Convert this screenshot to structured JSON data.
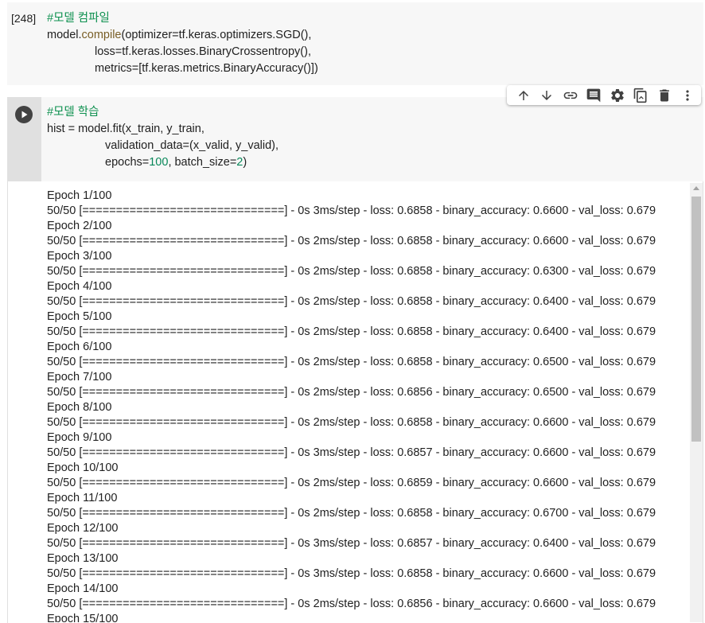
{
  "cell1": {
    "exec_count": "[248]",
    "line1": "#모델 컴파일",
    "line2_a": "model.",
    "line2_fn": "compile",
    "line2_b": "(optimizer=tf.keras.optimizers.SGD(),",
    "line3": "loss=tf.keras.losses.BinaryCrossentropy(),",
    "line4": "metrics=[tf.keras.metrics.BinaryAccuracy()])"
  },
  "cell2": {
    "line1": "#모델 학습",
    "line2": "hist = model.fit(x_train, y_train,",
    "line3": "validation_data=(x_valid, y_valid),",
    "line4_a": "epochs=",
    "line4_n1": "100",
    "line4_b": ", batch_size=",
    "line4_n2": "2",
    "line4_c": ")"
  },
  "toolbar": {
    "icons": [
      "arrow-up-icon",
      "arrow-down-icon",
      "link-icon",
      "comment-icon",
      "gear-icon",
      "mirror-cell-icon",
      "delete-icon",
      "more-vert-icon"
    ]
  },
  "output": {
    "lines": [
      "Epoch 1/100",
      "50/50 [==============================] - 0s 3ms/step - loss: 0.6858 - binary_accuracy: 0.6600 - val_loss: 0.679",
      "Epoch 2/100",
      "50/50 [==============================] - 0s 2ms/step - loss: 0.6858 - binary_accuracy: 0.6600 - val_loss: 0.679",
      "Epoch 3/100",
      "50/50 [==============================] - 0s 2ms/step - loss: 0.6858 - binary_accuracy: 0.6300 - val_loss: 0.679",
      "Epoch 4/100",
      "50/50 [==============================] - 0s 2ms/step - loss: 0.6858 - binary_accuracy: 0.6400 - val_loss: 0.679",
      "Epoch 5/100",
      "50/50 [==============================] - 0s 2ms/step - loss: 0.6858 - binary_accuracy: 0.6400 - val_loss: 0.679",
      "Epoch 6/100",
      "50/50 [==============================] - 0s 2ms/step - loss: 0.6858 - binary_accuracy: 0.6500 - val_loss: 0.679",
      "Epoch 7/100",
      "50/50 [==============================] - 0s 2ms/step - loss: 0.6856 - binary_accuracy: 0.6500 - val_loss: 0.679",
      "Epoch 8/100",
      "50/50 [==============================] - 0s 2ms/step - loss: 0.6858 - binary_accuracy: 0.6600 - val_loss: 0.679",
      "Epoch 9/100",
      "50/50 [==============================] - 0s 3ms/step - loss: 0.6857 - binary_accuracy: 0.6600 - val_loss: 0.679",
      "Epoch 10/100",
      "50/50 [==============================] - 0s 2ms/step - loss: 0.6859 - binary_accuracy: 0.6600 - val_loss: 0.679",
      "Epoch 11/100",
      "50/50 [==============================] - 0s 2ms/step - loss: 0.6858 - binary_accuracy: 0.6700 - val_loss: 0.679",
      "Epoch 12/100",
      "50/50 [==============================] - 0s 3ms/step - loss: 0.6857 - binary_accuracy: 0.6400 - val_loss: 0.679",
      "Epoch 13/100",
      "50/50 [==============================] - 0s 3ms/step - loss: 0.6858 - binary_accuracy: 0.6600 - val_loss: 0.679",
      "Epoch 14/100",
      "50/50 [==============================] - 0s 2ms/step - loss: 0.6856 - binary_accuracy: 0.6600 - val_loss: 0.679",
      "Epoch 15/100"
    ]
  },
  "colors": {
    "comment": "#0d904f",
    "function": "#795e26",
    "number": "#09885a",
    "text": "#212121"
  }
}
